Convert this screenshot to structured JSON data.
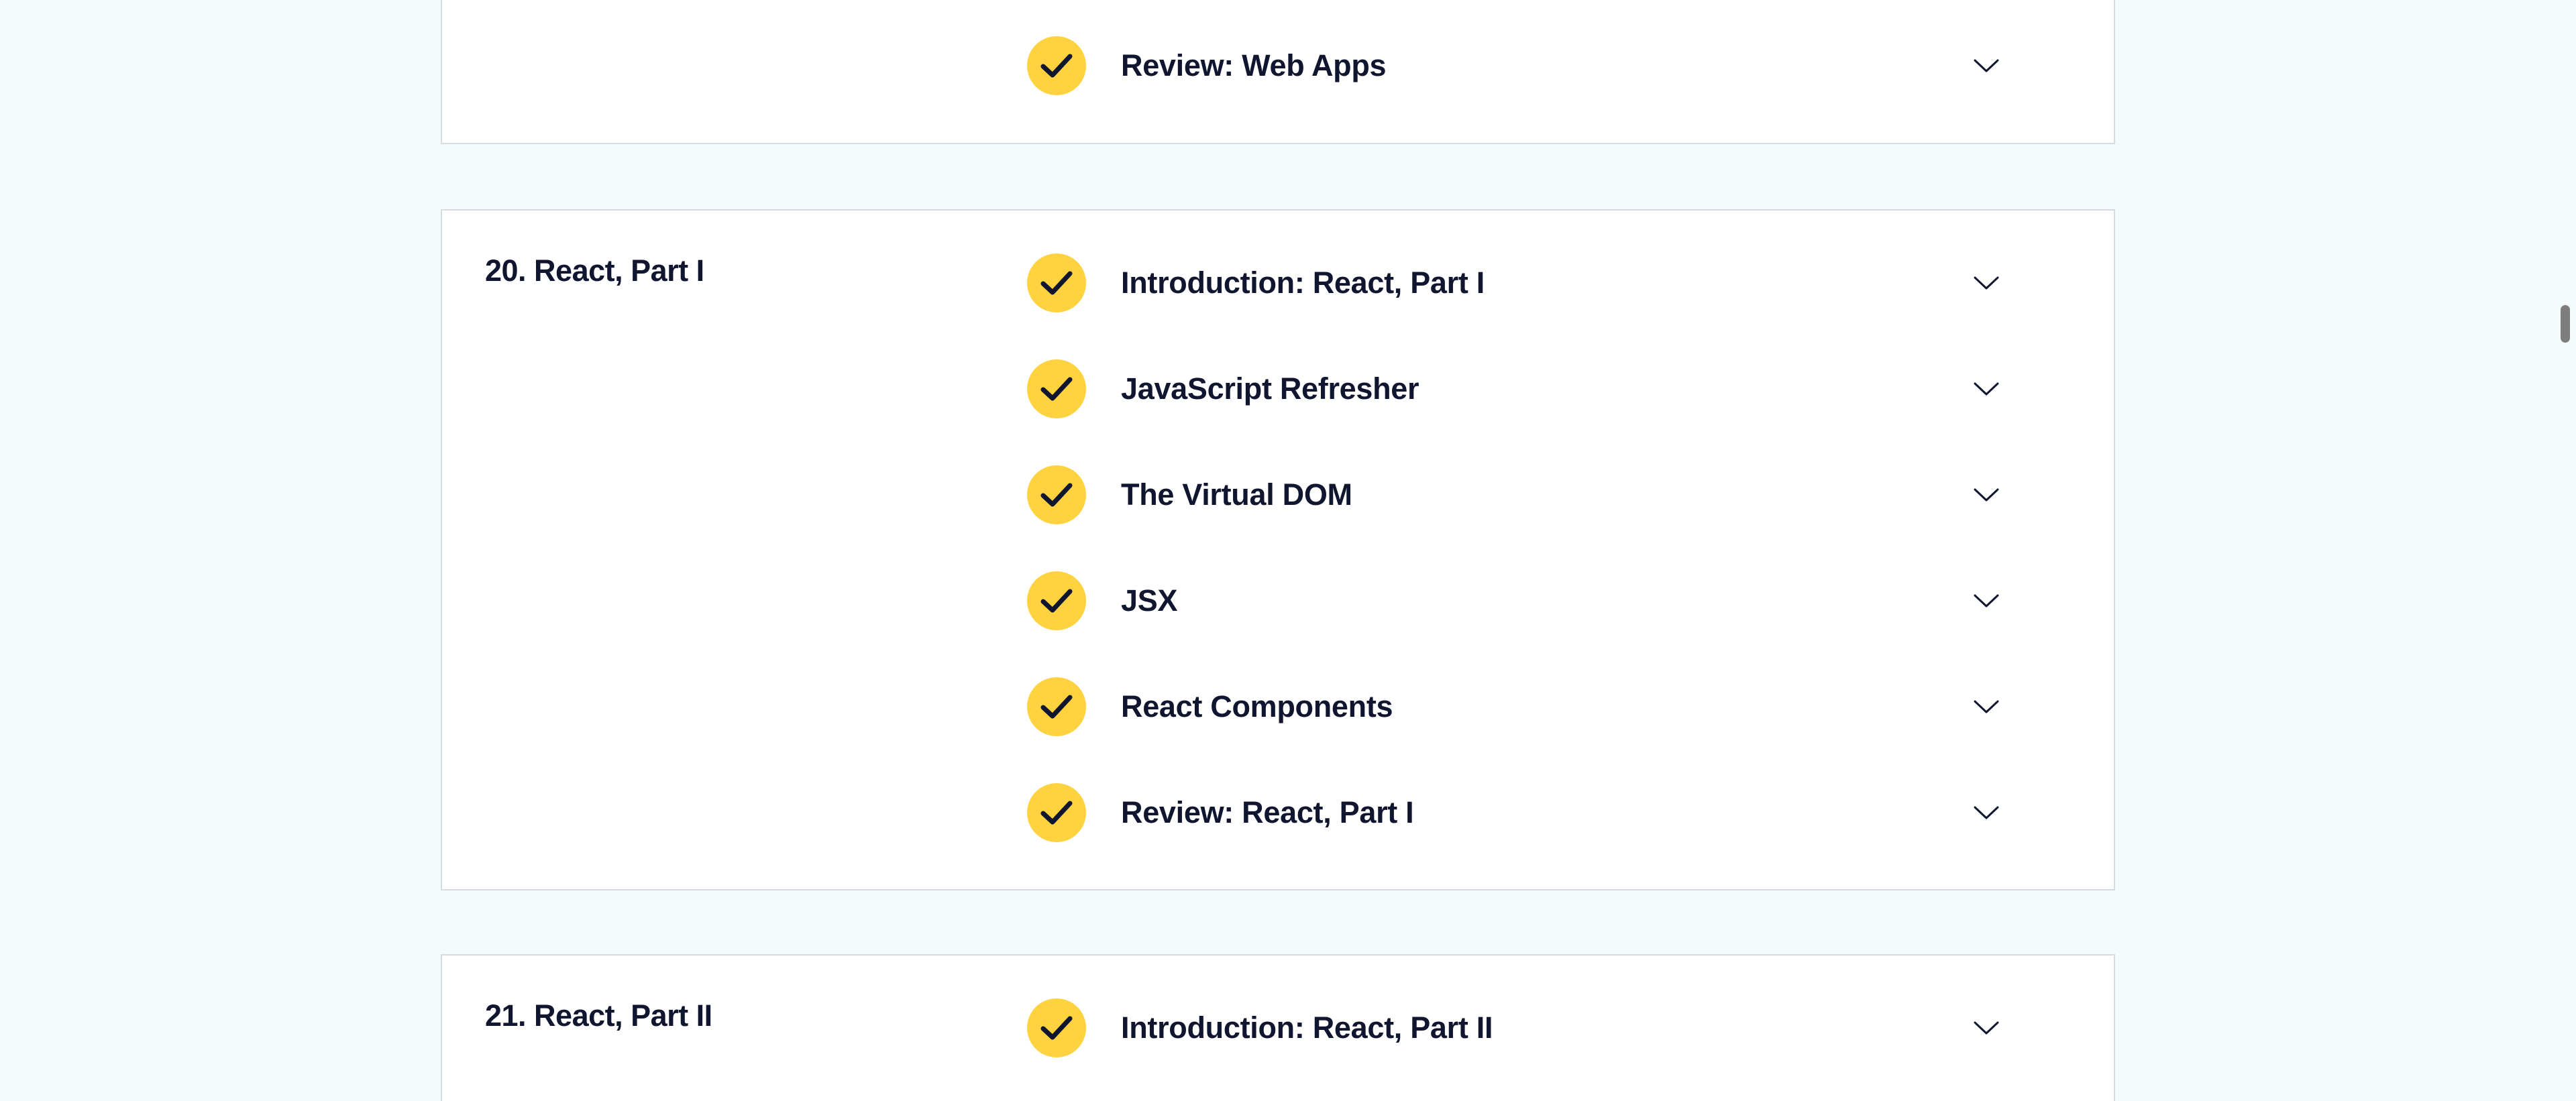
{
  "modules": [
    {
      "title": "",
      "lessons": [
        {
          "label": "Review: Web Apps",
          "completed": true
        }
      ]
    },
    {
      "title": "20. React, Part I",
      "lessons": [
        {
          "label": "Introduction: React, Part I",
          "completed": true
        },
        {
          "label": "JavaScript Refresher",
          "completed": true
        },
        {
          "label": "The Virtual DOM",
          "completed": true
        },
        {
          "label": "JSX",
          "completed": true
        },
        {
          "label": "React Components",
          "completed": true
        },
        {
          "label": "Review: React, Part I",
          "completed": true
        }
      ]
    },
    {
      "title": "21. React, Part II",
      "lessons": [
        {
          "label": "Introduction: React, Part II",
          "completed": true
        }
      ]
    }
  ],
  "icons": {
    "completed": "checkmark-icon",
    "expand": "chevron-down-icon"
  },
  "colors": {
    "page_background": "#f4fbfd",
    "card_border": "#d6dbe1",
    "check_fill": "#ffd23f",
    "text": "#10162f"
  }
}
